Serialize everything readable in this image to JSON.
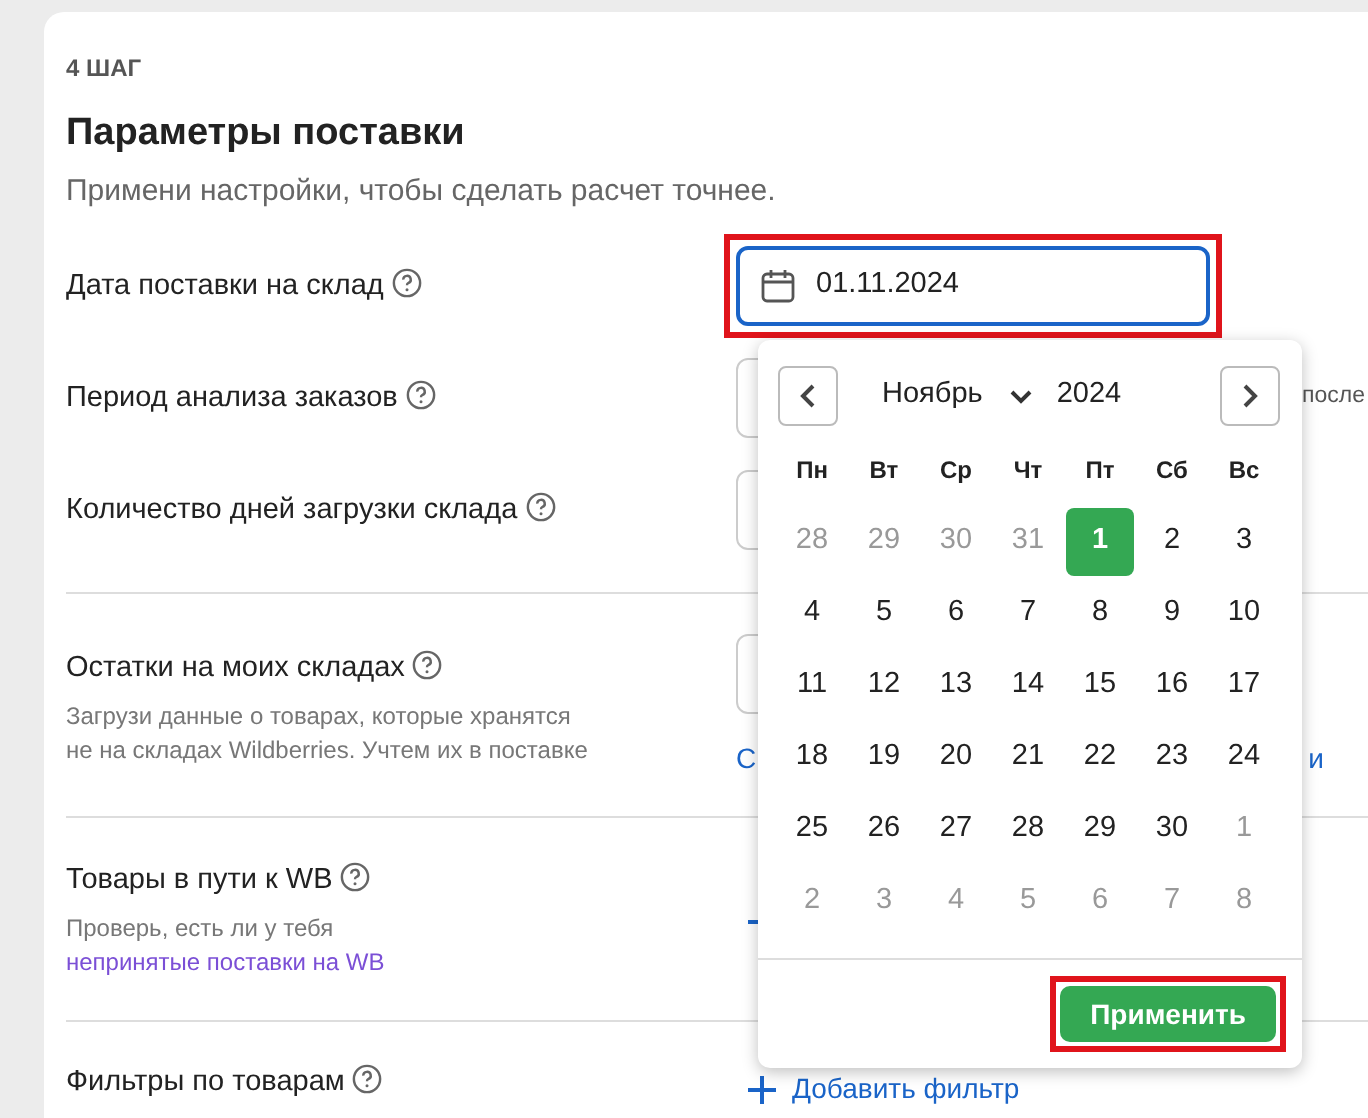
{
  "step": "4 ШАГ",
  "title": "Параметры поставки",
  "subtitle": "Примени настройки, чтобы сделать расчет точнее.",
  "params": [
    {
      "kind": "date",
      "label": "Дата поставки на склад",
      "value": "01.11.2024",
      "highlighted": true,
      "divider_before": false
    },
    {
      "kind": "select",
      "label": "Период анализа заказов",
      "trailing_text": "после",
      "divider_before": false
    },
    {
      "kind": "select",
      "label": "Количество дней загрузки склада",
      "divider_before": false
    },
    {
      "kind": "upload",
      "label": "Остатки на моих складах",
      "description": "Загрузи данные о товарах, которые хранятся не на складах Wildberries. Учтем их в поставке",
      "link_fragments": [
        "С",
        "и"
      ],
      "divider_before": true
    },
    {
      "kind": "add",
      "label": "Товары в пути к WB",
      "description": "Проверь, есть ли у тебя",
      "link": "непринятые поставки на WB",
      "divider_before": true
    },
    {
      "kind": "add",
      "label": "Фильтры по товарам",
      "action": "Добавить фильтр",
      "divider_before": true
    }
  ],
  "date_picker": {
    "month": "Ноябрь",
    "year": "2024",
    "weekdays": [
      "Пн",
      "Вт",
      "Ср",
      "Чт",
      "Пт",
      "Сб",
      "Вс"
    ],
    "days": [
      {
        "label": "28",
        "outside": true,
        "selected": false
      },
      {
        "label": "29",
        "outside": true,
        "selected": false
      },
      {
        "label": "30",
        "outside": true,
        "selected": false
      },
      {
        "label": "31",
        "outside": true,
        "selected": false
      },
      {
        "label": "1",
        "outside": false,
        "selected": true
      },
      {
        "label": "2",
        "outside": false,
        "selected": false
      },
      {
        "label": "3",
        "outside": false,
        "selected": false
      },
      {
        "label": "4",
        "outside": false,
        "selected": false
      },
      {
        "label": "5",
        "outside": false,
        "selected": false
      },
      {
        "label": "6",
        "outside": false,
        "selected": false
      },
      {
        "label": "7",
        "outside": false,
        "selected": false
      },
      {
        "label": "8",
        "outside": false,
        "selected": false
      },
      {
        "label": "9",
        "outside": false,
        "selected": false
      },
      {
        "label": "10",
        "outside": false,
        "selected": false
      },
      {
        "label": "11",
        "outside": false,
        "selected": false
      },
      {
        "label": "12",
        "outside": false,
        "selected": false
      },
      {
        "label": "13",
        "outside": false,
        "selected": false
      },
      {
        "label": "14",
        "outside": false,
        "selected": false
      },
      {
        "label": "15",
        "outside": false,
        "selected": false
      },
      {
        "label": "16",
        "outside": false,
        "selected": false
      },
      {
        "label": "17",
        "outside": false,
        "selected": false
      },
      {
        "label": "18",
        "outside": false,
        "selected": false
      },
      {
        "label": "19",
        "outside": false,
        "selected": false
      },
      {
        "label": "20",
        "outside": false,
        "selected": false
      },
      {
        "label": "21",
        "outside": false,
        "selected": false
      },
      {
        "label": "22",
        "outside": false,
        "selected": false
      },
      {
        "label": "23",
        "outside": false,
        "selected": false
      },
      {
        "label": "24",
        "outside": false,
        "selected": false
      },
      {
        "label": "25",
        "outside": false,
        "selected": false
      },
      {
        "label": "26",
        "outside": false,
        "selected": false
      },
      {
        "label": "27",
        "outside": false,
        "selected": false
      },
      {
        "label": "28",
        "outside": false,
        "selected": false
      },
      {
        "label": "29",
        "outside": false,
        "selected": false
      },
      {
        "label": "30",
        "outside": false,
        "selected": false
      },
      {
        "label": "1",
        "outside": true,
        "selected": false
      },
      {
        "label": "2",
        "outside": true,
        "selected": false
      },
      {
        "label": "3",
        "outside": true,
        "selected": false
      },
      {
        "label": "4",
        "outside": true,
        "selected": false
      },
      {
        "label": "5",
        "outside": true,
        "selected": false
      },
      {
        "label": "6",
        "outside": true,
        "selected": false
      },
      {
        "label": "7",
        "outside": true,
        "selected": false
      },
      {
        "label": "8",
        "outside": true,
        "selected": false
      }
    ],
    "apply_button": {
      "label": "Применить",
      "highlighted": true
    }
  }
}
